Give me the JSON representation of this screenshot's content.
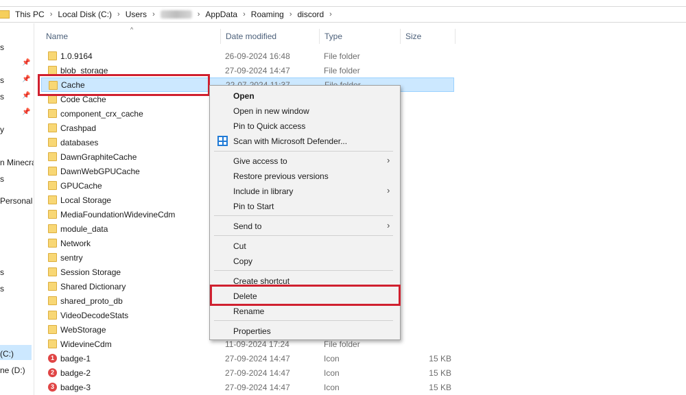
{
  "address": {
    "crumbs": [
      "This PC",
      "Local Disk (C:)",
      "Users",
      "AppData",
      "Roaming",
      "discord"
    ]
  },
  "nav": {
    "items": [
      "s",
      "s",
      "s",
      "y",
      "n Minecra",
      "s",
      "Personal",
      "s",
      "s",
      "(C:)",
      "ne (D:)"
    ]
  },
  "columns": {
    "name": "Name",
    "date": "Date modified",
    "type": "Type",
    "size": "Size"
  },
  "rows": [
    {
      "name": "1.0.9164",
      "date": "26-09-2024 16:48",
      "type": "File folder",
      "size": ""
    },
    {
      "name": "blob_storage",
      "date": "27-09-2024 14:47",
      "type": "File folder",
      "size": ""
    },
    {
      "name": "Cache",
      "date": "22-07-2024 11:37",
      "type": "File folder",
      "size": ""
    },
    {
      "name": "Code Cache",
      "date": "",
      "type": "",
      "size": ""
    },
    {
      "name": "component_crx_cache",
      "date": "",
      "type": "",
      "size": ""
    },
    {
      "name": "Crashpad",
      "date": "",
      "type": "",
      "size": ""
    },
    {
      "name": "databases",
      "date": "",
      "type": "",
      "size": ""
    },
    {
      "name": "DawnGraphiteCache",
      "date": "",
      "type": "",
      "size": ""
    },
    {
      "name": "DawnWebGPUCache",
      "date": "",
      "type": "",
      "size": ""
    },
    {
      "name": "GPUCache",
      "date": "",
      "type": "",
      "size": ""
    },
    {
      "name": "Local Storage",
      "date": "",
      "type": "",
      "size": ""
    },
    {
      "name": "MediaFoundationWidevineCdm",
      "date": "",
      "type": "",
      "size": ""
    },
    {
      "name": "module_data",
      "date": "",
      "type": "",
      "size": ""
    },
    {
      "name": "Network",
      "date": "",
      "type": "",
      "size": ""
    },
    {
      "name": "sentry",
      "date": "",
      "type": "",
      "size": ""
    },
    {
      "name": "Session Storage",
      "date": "",
      "type": "",
      "size": ""
    },
    {
      "name": "Shared Dictionary",
      "date": "",
      "type": "",
      "size": ""
    },
    {
      "name": "shared_proto_db",
      "date": "",
      "type": "",
      "size": ""
    },
    {
      "name": "VideoDecodeStats",
      "date": "",
      "type": "",
      "size": ""
    },
    {
      "name": "WebStorage",
      "date": "",
      "type": "",
      "size": ""
    },
    {
      "name": "WidevineCdm",
      "date": "11-09-2024 17:24",
      "type": "File folder",
      "size": ""
    },
    {
      "name": "badge-1",
      "date": "27-09-2024 14:47",
      "type": "Icon",
      "size": "15 KB",
      "badge": "1"
    },
    {
      "name": "badge-2",
      "date": "27-09-2024 14:47",
      "type": "Icon",
      "size": "15 KB",
      "badge": "2"
    },
    {
      "name": "badge-3",
      "date": "27-09-2024 14:47",
      "type": "Icon",
      "size": "15 KB",
      "badge": "3"
    }
  ],
  "context_menu": {
    "open": "Open",
    "open_new_window": "Open in new window",
    "pin_quick_access": "Pin to Quick access",
    "scan_defender": "Scan with Microsoft Defender...",
    "give_access": "Give access to",
    "restore_versions": "Restore previous versions",
    "include_library": "Include in library",
    "pin_start": "Pin to Start",
    "send_to": "Send to",
    "cut": "Cut",
    "copy": "Copy",
    "create_shortcut": "Create shortcut",
    "delete": "Delete",
    "rename": "Rename",
    "properties": "Properties"
  },
  "glyphs": {
    "chevron": "›",
    "pin": "📌",
    "sort": "^"
  },
  "colors": {
    "highlight": "#d0202f",
    "selection": "#cce8ff"
  }
}
